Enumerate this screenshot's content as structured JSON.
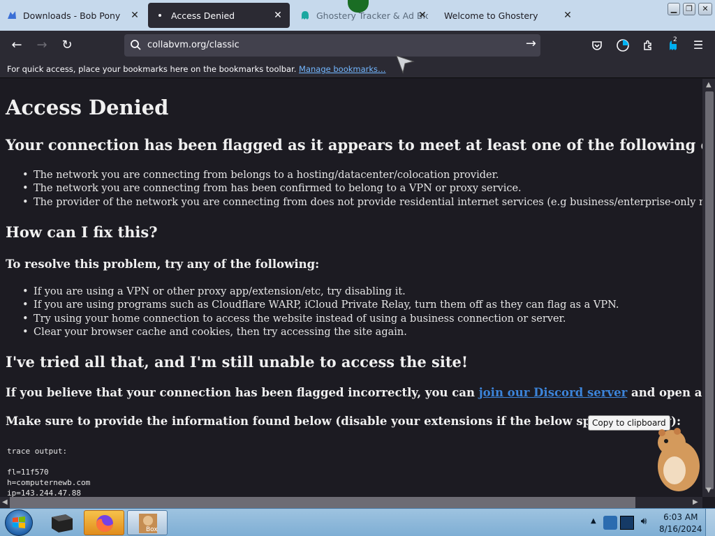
{
  "tabs": [
    {
      "title": "Downloads - Bob Pony",
      "active": false
    },
    {
      "title": "Access Denied",
      "active": true
    },
    {
      "title": "Ghostery Tracker & Ad Blocker",
      "active": false
    },
    {
      "title": "Welcome to Ghostery",
      "active": false
    }
  ],
  "toolbar": {
    "url": "collabvm.org/classic",
    "extensions_badge": "2"
  },
  "bookmarks_bar": {
    "message": "For quick access, place your bookmarks here on the bookmarks toolbar.",
    "manage_link": "Manage bookmarks…"
  },
  "page": {
    "title": "Access Denied",
    "criteria_heading": "Your connection has been flagged as it appears to meet at least one of the following criteria:",
    "criteria": [
      "The network you are connecting from belongs to a hosting/datacenter/colocation provider.",
      "The network you are connecting from has been confirmed to belong to a VPN or proxy service.",
      "The provider of the network you are connecting from does not provide residential internet services (e.g business/enterprise-only networks)."
    ],
    "fix_heading": "How can I fix this?",
    "resolve_heading": "To resolve this problem, try any of the following:",
    "fixes": [
      "If you are using a VPN or other proxy app/extension/etc, try disabling it.",
      "If you are using programs such as Cloudflare WARP, iCloud Private Relay, turn them off as they can flag as a VPN.",
      "Try using your home connection to access the website instead of using a business connection or server.",
      "Clear your browser cache and cookies, then try accessing the site again."
    ],
    "tried_heading": "I've tried all that, and I'm still unable to access the site!",
    "discord_prefix": "If you believe that your connection has been flagged incorrectly, you can ",
    "discord_link": "join our Discord server",
    "discord_suffix": " and open a ticket.",
    "provide_info": "Make sure to provide the information found below (disable your extensions if the below space is empty):",
    "copy_button": "Copy to clipboard",
    "trace_lines": [
      "trace output:",
      "",
      "fl=11f570",
      "h=computernewb.com",
      "ip=143.244.47.88"
    ]
  },
  "taskbar": {
    "time": "6:03 AM",
    "date": "8/16/2024",
    "box_label": "Box"
  },
  "colors": {
    "tab_bar": "#c6d9ec",
    "toolbar": "#2b2a33",
    "page_background": "#1c1b22",
    "link": "#3c84d9"
  }
}
